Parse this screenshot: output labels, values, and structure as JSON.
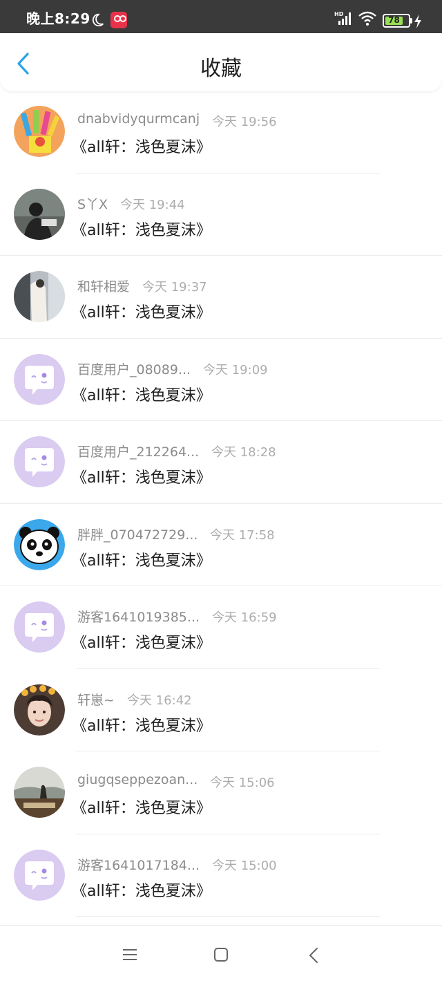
{
  "status_bar": {
    "time": "晚上8:29",
    "network": "HD",
    "battery": "78",
    "battery_level": 0.78,
    "battery_color": "#9adf53"
  },
  "header": {
    "title": "收藏",
    "back_icon": "chevron-left-icon",
    "accent_color": "#2aa3e8"
  },
  "favorites": [
    {
      "user": "dnabvidyqurmcanj",
      "time": "今天 19:56",
      "title": "《all轩：浅色夏沫》",
      "avatar": "colorful-toys"
    },
    {
      "user": "S丫X",
      "time": "今天 19:44",
      "title": "《all轩：浅色夏沫》",
      "avatar": "photo-dark"
    },
    {
      "user": "和轩相爱",
      "time": "今天 19:37",
      "title": "《all轩：浅色夏沫》",
      "avatar": "photo-white"
    },
    {
      "user": "百度用户_08089...",
      "time": "今天 19:09",
      "title": "《all轩：浅色夏沫》",
      "avatar": "default-purple"
    },
    {
      "user": "百度用户_212264...",
      "time": "今天 18:28",
      "title": "《all轩：浅色夏沫》",
      "avatar": "default-purple"
    },
    {
      "user": "胖胖_070472729...",
      "time": "今天 17:58",
      "title": "《all轩：浅色夏沫》",
      "avatar": "panda"
    },
    {
      "user": "游客1641019385...",
      "time": "今天 16:59",
      "title": "《all轩：浅色夏沫》",
      "avatar": "default-purple"
    },
    {
      "user": "轩崽~",
      "time": "今天 16:42",
      "title": "《all轩：浅色夏沫》",
      "avatar": "photo-person"
    },
    {
      "user": "giugqseppezoan...",
      "time": "今天 15:06",
      "title": "《all轩：浅色夏沫》",
      "avatar": "photo-landscape"
    },
    {
      "user": "游客1641017184...",
      "time": "今天 15:00",
      "title": "《all轩：浅色夏沫》",
      "avatar": "default-purple"
    }
  ],
  "nav_bar": {
    "menu_icon": "menu-icon",
    "home_icon": "home-square-icon",
    "back_icon": "back-triangle-icon"
  }
}
